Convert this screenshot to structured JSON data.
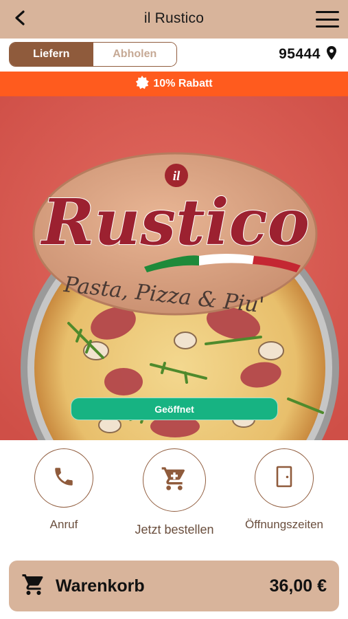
{
  "header": {
    "title": "il Rustico",
    "back_icon": "chevron-left-icon",
    "menu_icon": "hamburger-menu-icon"
  },
  "delivery": {
    "options": [
      "Liefern",
      "Abholen"
    ],
    "selected": "Liefern",
    "zip": "95444",
    "zip_icon": "location-pin-icon"
  },
  "promo": {
    "icon": "badge-icon",
    "text": "10% Rabatt",
    "color": "#ff5b1e"
  },
  "hero": {
    "logo": {
      "prefix": "il",
      "name": "Rustico",
      "tagline": "Pasta, Pizza & Piu'"
    },
    "status": "Geöffnet",
    "status_color": "#17b382"
  },
  "actions": [
    {
      "icon": "phone-icon",
      "label": "Anruf"
    },
    {
      "icon": "cart-icon",
      "label": "Jetzt bestellen"
    },
    {
      "icon": "door-icon",
      "label": "Öffnungszeiten"
    }
  ],
  "cart": {
    "icon": "cart-icon",
    "label": "Warenkorb",
    "total": "36,00 €"
  },
  "colors": {
    "brand_tan": "#d8b49b",
    "brand_brown": "#8f5b3c",
    "accent_red": "#dd5f57"
  }
}
